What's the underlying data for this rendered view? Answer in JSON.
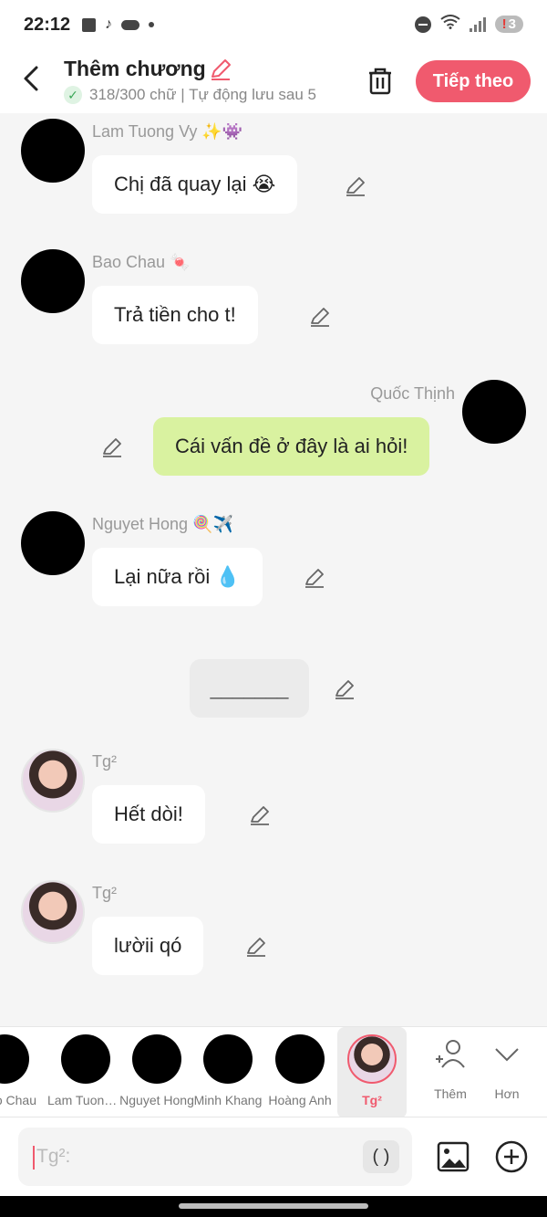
{
  "status": {
    "time": "22:12",
    "battery": "3",
    "battery_alert": "!",
    "icons": [
      "checkbox-icon",
      "tiktok-icon",
      "cloud-icon",
      "dot-icon",
      "dnd-icon",
      "wifi-icon",
      "signal-icon",
      "battery-icon"
    ]
  },
  "header": {
    "title": "Thêm chương",
    "subtitle": "318/300 chữ | Tự động lưu sau 5",
    "next_label": "Tiếp theo",
    "accent": "#f05a6e"
  },
  "messages": [
    {
      "sender": "Lam Tuong Vy ✨👾",
      "text": "Chị đã quay lại 😭"
    },
    {
      "sender": "Bao Chau 🍬",
      "text": "Trả tiền cho t!"
    },
    {
      "sender": "Quốc Thịnh",
      "text": "Cái vấn đề ở đây là ai hỏi!"
    },
    {
      "sender": "Nguyet Hong 🍭✈️",
      "text": "Lại nữa rồi 💧"
    },
    {
      "sender": "",
      "text": "_______"
    },
    {
      "sender": "Tg²",
      "text": "Hết dòi!"
    },
    {
      "sender": "Tg²",
      "text": "lườii qó"
    }
  ],
  "characters": [
    {
      "name": "Bao Chau"
    },
    {
      "name": "Lam Tuong Vy"
    },
    {
      "name": "Nguyet Hong"
    },
    {
      "name": "Minh Khang"
    },
    {
      "name": "Hoàng Anh"
    },
    {
      "name": "Tg²"
    }
  ],
  "picker_actions": {
    "add_label": "Thêm",
    "more_label": "Hơn"
  },
  "composer": {
    "placeholder": "Tg²:",
    "paren_label": "( )"
  },
  "colors": {
    "bubble_mine": "#d9f2a0",
    "bubble_other": "#ffffff",
    "background": "#f5f5f5"
  }
}
